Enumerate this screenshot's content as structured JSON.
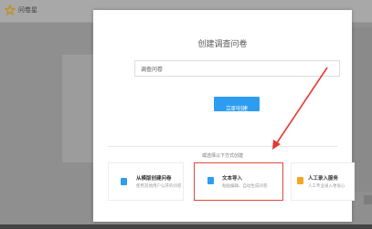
{
  "app": {
    "title": "问卷星"
  },
  "modal": {
    "title": "创建调查问卷",
    "input_value": "调查问卷",
    "create_button": "立即创建",
    "divider_label": "或选择以下方式创建",
    "options": [
      {
        "title": "从模版创建问卷",
        "desc": "使用其他用户公开的问卷"
      },
      {
        "title": "文本导入",
        "desc": "粘贴编辑、自动生成问卷"
      },
      {
        "title": "人工录入服务",
        "desc": "人工专业录入更省心"
      }
    ]
  },
  "colors": {
    "accent": "#2e9cf1",
    "highlight_box": "#e04a3c",
    "arrow": "#e53935",
    "overlay": "#8f8f8f"
  },
  "icons": {
    "app": "star-icon",
    "option1": "document-icon",
    "option2": "text-file-icon",
    "option3": "service-icon"
  }
}
